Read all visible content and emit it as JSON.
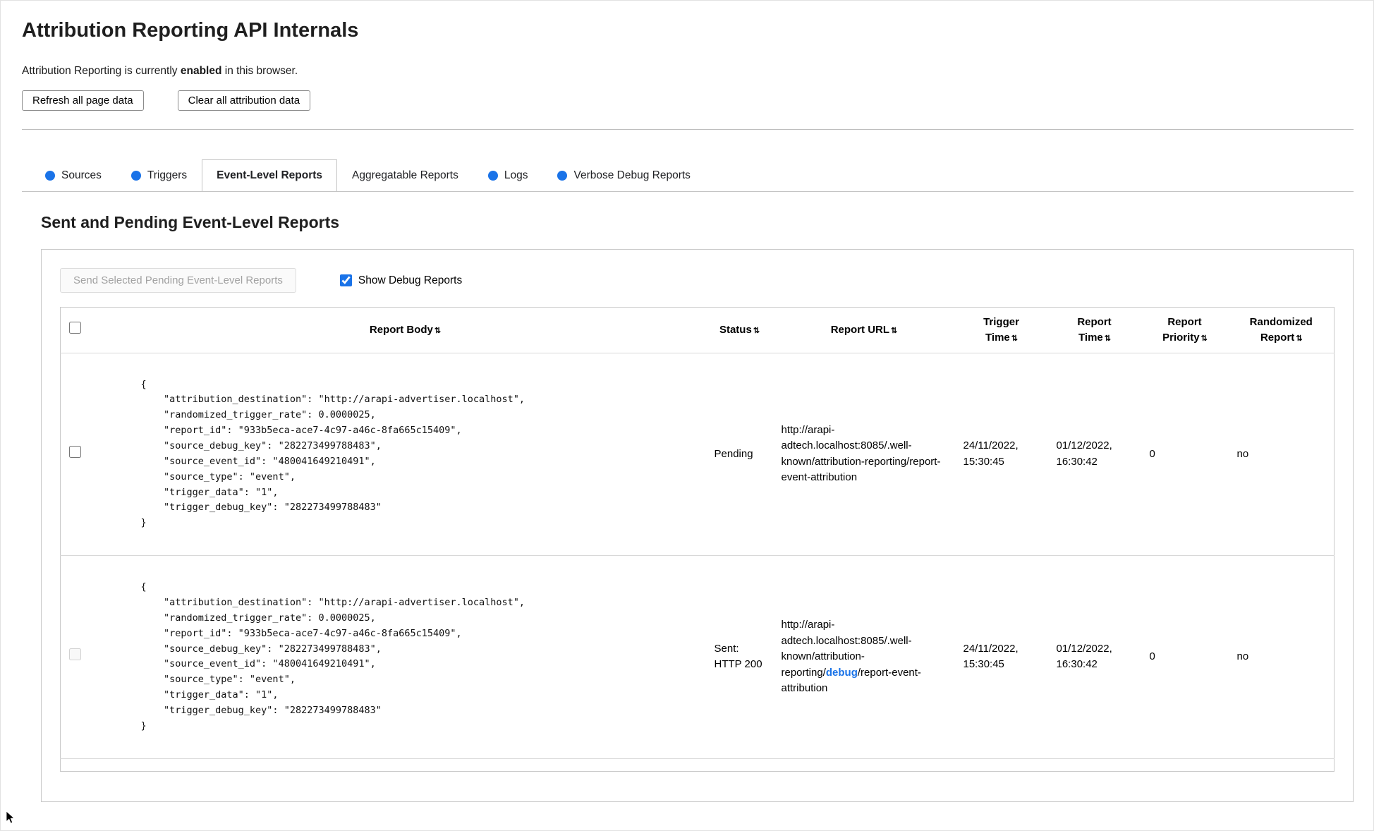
{
  "header": {
    "title": "Attribution Reporting API Internals",
    "status_prefix": "Attribution Reporting is currently ",
    "status_bold": "enabled",
    "status_suffix": " in this browser.",
    "refresh_button": "Refresh all page data",
    "clear_button": "Clear all attribution data"
  },
  "icons": {
    "sort": "⇅"
  },
  "colors": {
    "accent": "#1a73e8"
  },
  "tabs": [
    {
      "label": "Sources",
      "has_dot": true,
      "active": false
    },
    {
      "label": "Triggers",
      "has_dot": true,
      "active": false
    },
    {
      "label": "Event-Level Reports",
      "has_dot": false,
      "active": true
    },
    {
      "label": "Aggregatable Reports",
      "has_dot": false,
      "active": false
    },
    {
      "label": "Logs",
      "has_dot": true,
      "active": false
    },
    {
      "label": "Verbose Debug Reports",
      "has_dot": true,
      "active": false
    }
  ],
  "section": {
    "heading": "Sent and Pending Event-Level Reports",
    "send_button": "Send Selected Pending Event-Level Reports",
    "show_debug_label": "Show Debug Reports",
    "show_debug_checked": "checked"
  },
  "table": {
    "headers": {
      "report_body": "Report Body",
      "status": "Status",
      "report_url": "Report URL",
      "trigger_time": "Trigger Time",
      "report_time": "Report Time",
      "report_priority": "Report Priority",
      "randomized_report": "Randomized Report"
    },
    "rows": [
      {
        "report_body": "{\n    \"attribution_destination\": \"http://arapi-advertiser.localhost\",\n    \"randomized_trigger_rate\": 0.0000025,\n    \"report_id\": \"933b5eca-ace7-4c97-a46c-8fa665c15409\",\n    \"source_debug_key\": \"282273499788483\",\n    \"source_event_id\": \"480041649210491\",\n    \"source_type\": \"event\",\n    \"trigger_data\": \"1\",\n    \"trigger_debug_key\": \"282273499788483\"\n}",
        "status": "Pending",
        "url_prefix": "http://arapi-adtech.localhost:8085/.well-known/attribution-reporting/report-event-attribution",
        "url_debug": "",
        "url_suffix": "",
        "trigger_time": "24/11/2022, 15:30:45",
        "report_time": "01/12/2022, 16:30:42",
        "report_priority": "0",
        "randomized_report": "no"
      },
      {
        "report_body": "{\n    \"attribution_destination\": \"http://arapi-advertiser.localhost\",\n    \"randomized_trigger_rate\": 0.0000025,\n    \"report_id\": \"933b5eca-ace7-4c97-a46c-8fa665c15409\",\n    \"source_debug_key\": \"282273499788483\",\n    \"source_event_id\": \"480041649210491\",\n    \"source_type\": \"event\",\n    \"trigger_data\": \"1\",\n    \"trigger_debug_key\": \"282273499788483\"\n}",
        "status": "Sent: HTTP 200",
        "url_prefix": "http://arapi-adtech.localhost:8085/.well-known/attribution-reporting/",
        "url_debug": "debug",
        "url_suffix": "/report-event-attribution",
        "trigger_time": "24/11/2022, 15:30:45",
        "report_time": "01/12/2022, 16:30:42",
        "report_priority": "0",
        "randomized_report": "no"
      }
    ]
  }
}
